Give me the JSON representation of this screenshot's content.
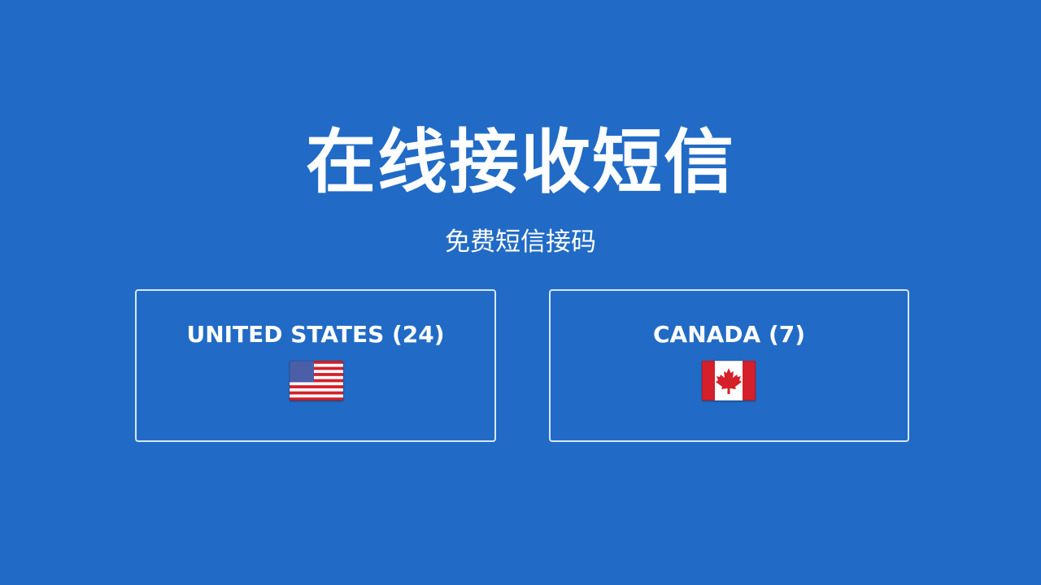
{
  "hero": {
    "title": "在线接收短信",
    "subtitle": "免费短信接码"
  },
  "countries": [
    {
      "label": "UNITED STATES (24)",
      "flag_icon": "us-flag-icon"
    },
    {
      "label": "CANADA (7)",
      "flag_icon": "canada-flag-icon"
    }
  ],
  "colors": {
    "background": "#216bc6",
    "text": "#ffffff",
    "card_border": "#d8e6f7",
    "flag_red": "#d51f2a",
    "flag_blue": "#4a5fa8"
  }
}
